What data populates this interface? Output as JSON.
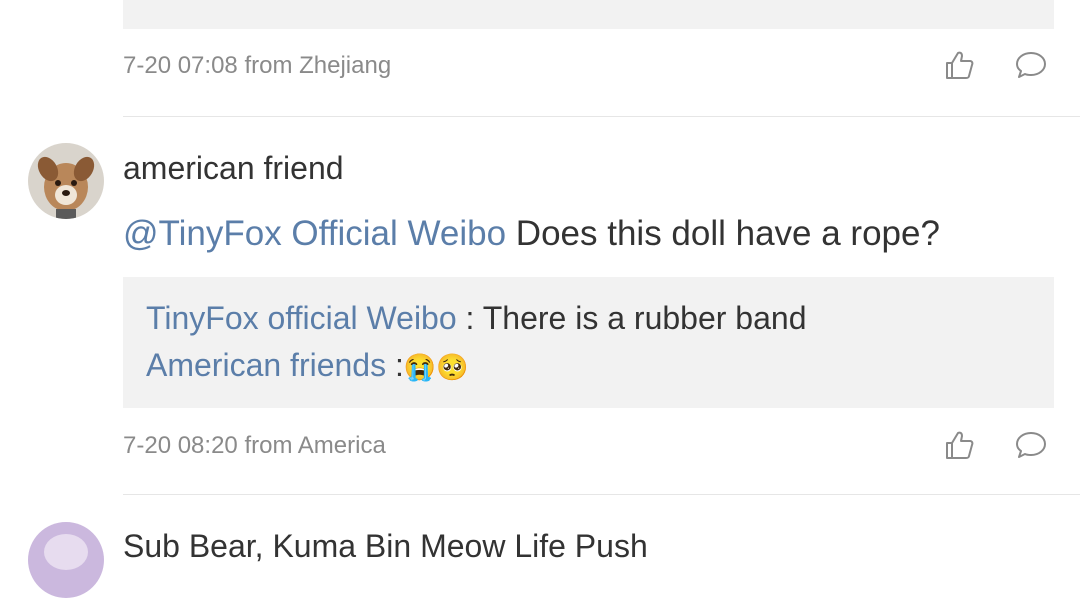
{
  "comments": [
    {
      "timestamp": "7-20 07:08",
      "location_prefix": "from",
      "location": "Zhejiang"
    },
    {
      "author": "american friend",
      "mention": "@TinyFox Official Weibo",
      "text": "Does this doll have a rope?",
      "replies": [
        {
          "author": "TinyFox official Weibo",
          "separator": " : ",
          "text": "There is a rubber band"
        },
        {
          "author": "American friends",
          "separator": " :",
          "emoji1": "😭",
          "emoji2": "🥺"
        }
      ],
      "timestamp": "7-20 08:20",
      "location_prefix": "from",
      "location": "America"
    },
    {
      "author": "Sub Bear, Kuma Bin Meow Life Push"
    }
  ],
  "colors": {
    "link": "#5b7ea9",
    "meta": "#8a8a8a",
    "quote_bg": "#f2f2f2",
    "text": "#333333"
  },
  "icons": [
    "thumb-up-icon",
    "comment-bubble-icon"
  ]
}
